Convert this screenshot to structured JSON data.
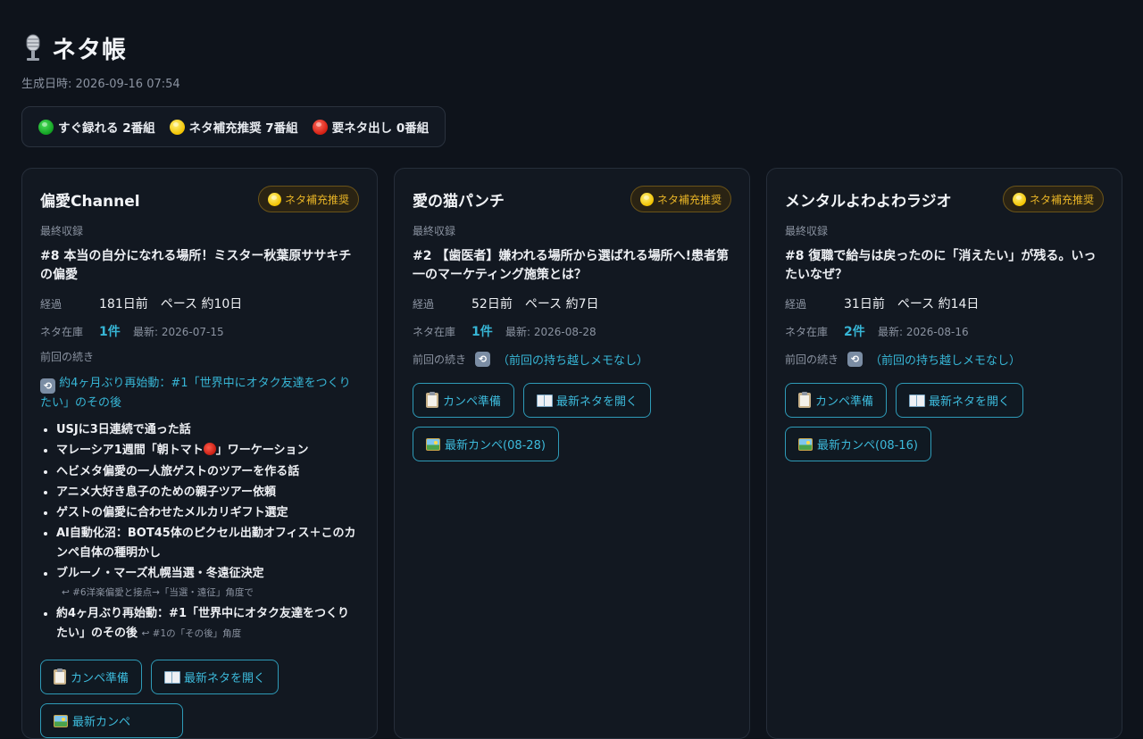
{
  "header": {
    "title": "ネタ帳",
    "generated": "生成日時: 2026-09-16 07:54",
    "icon": "microphone-icon"
  },
  "summary": {
    "ready": "すぐ録れる 2番組",
    "recommend": "ネタ補充推奨 7番組",
    "need": "要ネタ出し 0番組",
    "colors": {
      "green": "#12a022",
      "yellow": "#f2c200",
      "red": "#d41f12"
    }
  },
  "labels": {
    "last_recorded": "最終収録",
    "elapsed": "経過",
    "stock": "ネタ在庫",
    "previous": "前回の続き",
    "btn_prepare": "カンペ準備",
    "btn_open_latest": "最新ネタを開く"
  },
  "cards": [
    {
      "title": "偏愛Channel",
      "status": "ネタ補充推奨",
      "last_title": "#8 本当の自分になれる場所！ミスター秋葉原ササキチの偏愛",
      "elapsed": "181日前　ペース 約10日",
      "stock_count": "1件",
      "stock_latest": "最新: 2026-07-15",
      "continuation": "約4ヶ月ぶり再始動：#1「世界中にオタク友達をつくりたい」のその後",
      "topics": [
        "USJに3日連続で通った話",
        "マレーシア1週間「朝トマト",
        "」ワーケーション",
        "ヘビメタ偏愛の一人旅ゲストのツアーを作る話",
        "アニメ大好き息子のための親子ツアー依頼",
        "ゲストの偏愛に合わせたメルカリギフト選定",
        "AI自動化沼：BOT45体のピクセル出勤オフィス＋このカンペ自体の種明かし",
        "ブルーノ・マーズ札幌当選・冬遠征決定",
        "↩ #6洋楽偏愛と接点→「当選・遠征」角度で",
        "約4ヶ月ぶり再始動：#1「世界中にオタク友達をつくりたい」のその後",
        "↩ #1の「その後」角度"
      ],
      "btn_third": "最新カンペ"
    },
    {
      "title": "愛の猫パンチ",
      "status": "ネタ補充推奨",
      "last_title": "#2 【歯医者】嫌われる場所から選ばれる場所へ!患者第一のマーケティング施策とは？",
      "elapsed": "52日前　ペース 約7日",
      "stock_count": "1件",
      "stock_latest": "最新: 2026-08-28",
      "previous_note": "（前回の持ち越しメモなし）",
      "btn_latest_kanpe": "最新カンペ(08-28)"
    },
    {
      "title": "メンタルよわよわラジオ",
      "status": "ネタ補充推奨",
      "last_title": "#8 復職で給与は戻ったのに「消えたい」が残る。いったいなぜ？",
      "elapsed": "31日前　ペース 約14日",
      "stock_count": "2件",
      "stock_latest": "最新: 2026-08-16",
      "previous_note": "（前回の持ち越しメモなし）",
      "btn_latest_kanpe": "最新カンペ(08-16)"
    }
  ]
}
